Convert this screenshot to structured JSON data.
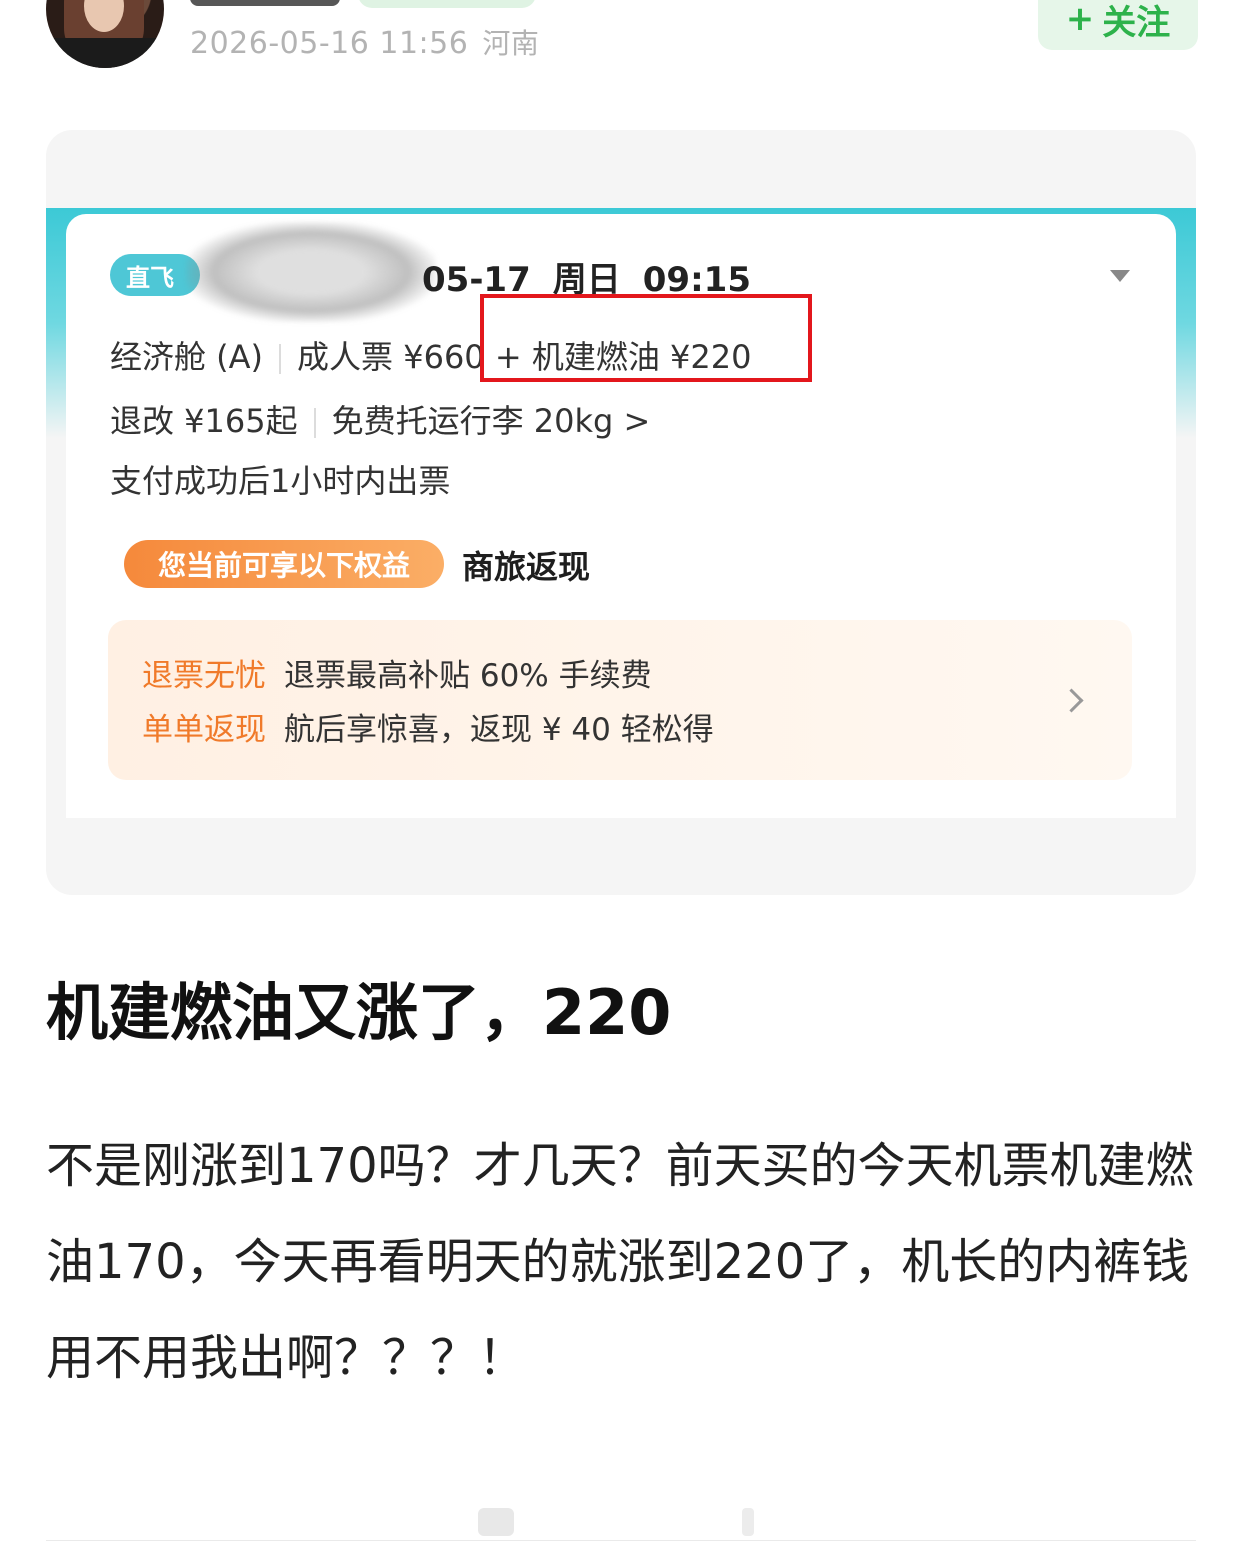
{
  "header": {
    "timestamp": "2026-05-16 11:56",
    "location": "河南",
    "follow_plus": "+",
    "follow_label": "关注"
  },
  "ticket": {
    "direct_tag": "直飞",
    "date": "05-17",
    "weekday": "周日",
    "time": "09:15",
    "cabin": "经济舱 (A)",
    "adult_fare": "成人票 ¥660",
    "fuel_fee": "+ 机建燃油 ¥220",
    "refund_change": "退改 ¥165起",
    "baggage": "免费托运行李 20kg >",
    "issue_note": "支付成功后1小时内出票",
    "benefit_pill": "您当前可享以下权益",
    "benefit_title": "商旅返现",
    "benefits": [
      {
        "tag": "退票无忧",
        "text": "退票最高补贴 60% 手续费"
      },
      {
        "tag": "单单返现",
        "text": "航后享惊喜，返现 ¥ 40 轻松得"
      }
    ]
  },
  "post": {
    "title": "机建燃油又涨了，220",
    "body": "不是刚涨到170吗？才几天？前天买的今天机票机建燃油170，今天再看明天的就涨到220了，机长的内裤钱用不用我出啊？？？！"
  },
  "colors": {
    "accent_green": "#2db24b",
    "teal": "#3cc9d6",
    "orange": "#f07a2a",
    "highlight_red": "#e3171c"
  }
}
